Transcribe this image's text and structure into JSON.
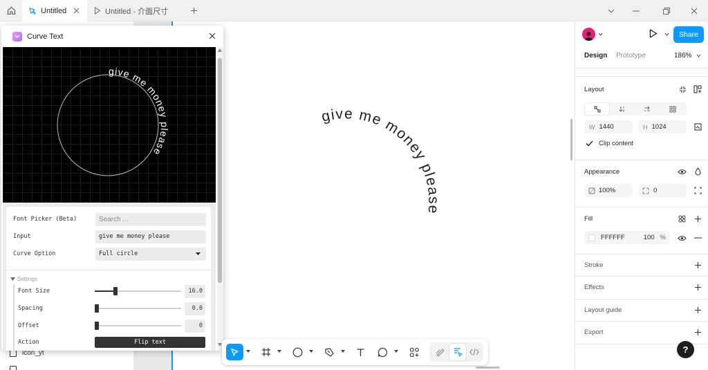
{
  "tabs": [
    {
      "label": "Untitled"
    },
    {
      "label": "Untitled - 介面尺寸"
    }
  ],
  "layers": {
    "visible_items": [
      {
        "label": "icon_yt"
      }
    ]
  },
  "plugin": {
    "title": "Curve Text",
    "preview_text": "give me money please",
    "font_picker_label": "Font Picker (Beta)",
    "search_placeholder": "Search ...",
    "input_label": "Input",
    "input_value": "give me money please",
    "curve_option_label": "Curve Option",
    "curve_option_value": "Full circle",
    "settings_label": "Settings",
    "font_size_label": "Font Size",
    "font_size_value": "16.0",
    "font_size_level": 0.23,
    "spacing_label": "Spacing",
    "spacing_value": "0.0",
    "spacing_level": 0,
    "offset_label": "Offset",
    "offset_value": "0",
    "offset_level": 0,
    "action_label": "Action",
    "flip_label": "Flip text"
  },
  "canvas": {
    "curved_text": "give me money please"
  },
  "right_panel": {
    "share_label": "Share",
    "tab_design": "Design",
    "tab_prototype": "Prototype",
    "zoom": "186%",
    "layout_title": "Layout",
    "w_label": "W",
    "w_value": "1440",
    "h_label": "H",
    "h_value": "1024",
    "clip_content_label": "Clip content",
    "appearance_title": "Appearance",
    "opacity_value": "100%",
    "radius_value": "0",
    "fill_title": "Fill",
    "fill_hex": "FFFFFF",
    "fill_opacity": "100",
    "fill_percent": "%",
    "stroke_title": "Stroke",
    "effects_title": "Effects",
    "layout_guide_title": "Layout guide",
    "export_title": "Export",
    "help_label": "?"
  },
  "colors": {
    "accent": "#0d99ff",
    "avatar": "#e61f7a"
  }
}
